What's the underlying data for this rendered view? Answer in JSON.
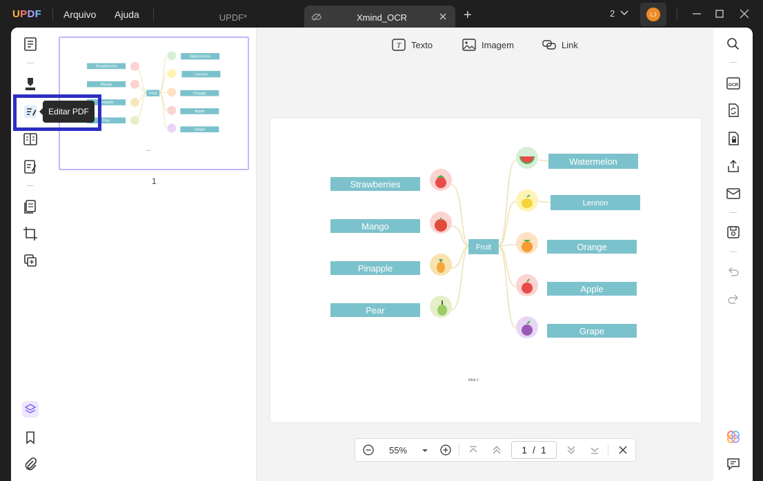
{
  "app": {
    "logo": "UPDF"
  },
  "menu": {
    "file": "Arquivo",
    "help": "Ajuda"
  },
  "tabs": [
    {
      "label": "UPDF*"
    },
    {
      "label": "Xmind_OCR"
    }
  ],
  "window_count": "2",
  "user": {
    "initials": "LJ"
  },
  "tooltip": {
    "text": "Editar PDF"
  },
  "thumbnail": {
    "page_label": "1"
  },
  "toolbar": {
    "text_label": "Texto",
    "image_label": "Imagem",
    "link_label": "Link"
  },
  "mindmap": {
    "center": "Fruit",
    "left": [
      "Strawberries",
      "Mango",
      "Pinapple",
      "Pear"
    ],
    "right": [
      "Watermelon",
      "Lennon",
      "Orange",
      "Apple",
      "Grape"
    ],
    "footer": "Fitcit J"
  },
  "bottom": {
    "zoom": "55%",
    "current_page": "1",
    "separator": "/",
    "total_pages": "1"
  },
  "colors": {
    "accent": "#8b6cff",
    "node": "#7cc2cc",
    "highlight": "#2c2ec4",
    "avatar": "#f08a24"
  }
}
